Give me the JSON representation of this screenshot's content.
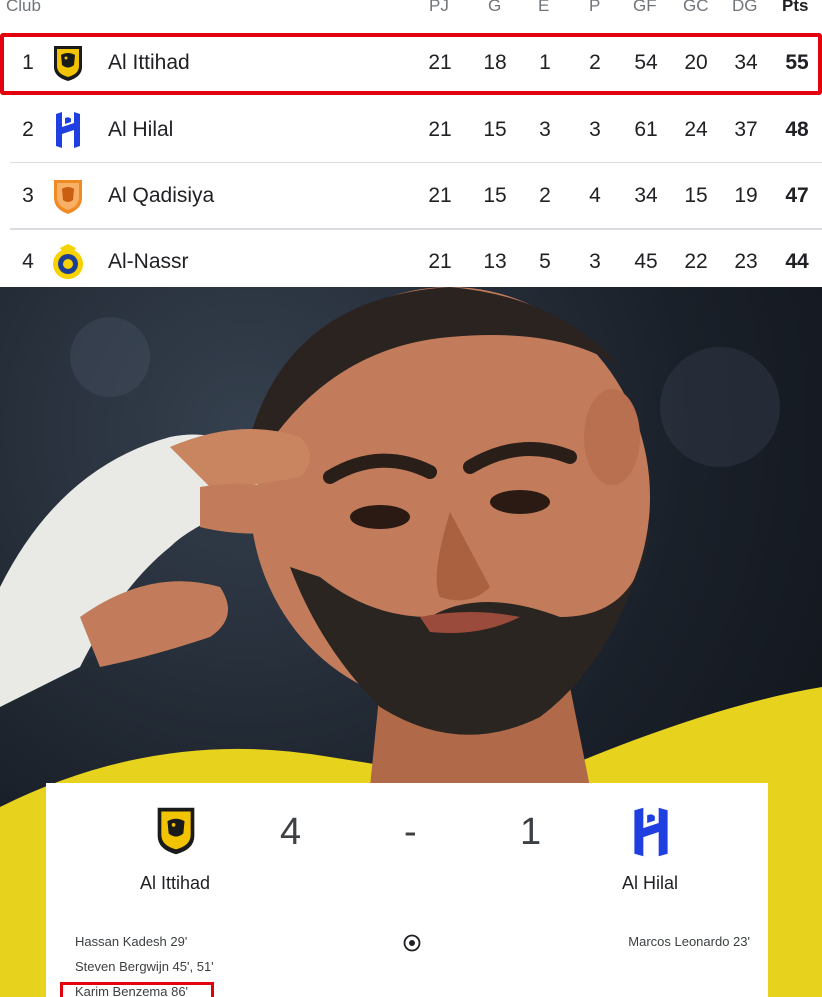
{
  "table": {
    "headers": {
      "club": "Club",
      "pj": "PJ",
      "g": "G",
      "e": "E",
      "p": "P",
      "gf": "GF",
      "gc": "GC",
      "dg": "DG",
      "pts": "Pts"
    },
    "rows": [
      {
        "rank": "1",
        "team": "Al Ittihad",
        "pj": "21",
        "g": "18",
        "e": "1",
        "p": "2",
        "gf": "54",
        "gc": "20",
        "dg": "34",
        "pts": "55",
        "logo": "al-ittihad-crest"
      },
      {
        "rank": "2",
        "team": "Al Hilal",
        "pj": "21",
        "g": "15",
        "e": "3",
        "p": "3",
        "gf": "61",
        "gc": "24",
        "dg": "37",
        "pts": "48",
        "logo": "al-hilal-crest"
      },
      {
        "rank": "3",
        "team": "Al Qadisiya",
        "pj": "21",
        "g": "15",
        "e": "2",
        "p": "4",
        "gf": "34",
        "gc": "15",
        "dg": "19",
        "pts": "47",
        "logo": "al-qadisiya-crest"
      },
      {
        "rank": "4",
        "team": "Al-Nassr",
        "pj": "21",
        "g": "13",
        "e": "5",
        "p": "3",
        "gf": "45",
        "gc": "22",
        "dg": "23",
        "pts": "44",
        "logo": "al-nassr-crest"
      }
    ],
    "highlight_color": "#e3000f"
  },
  "match": {
    "home_team": "Al Ittihad",
    "away_team": "Al Hilal",
    "home_score": "4",
    "separator": "-",
    "away_score": "1",
    "home_scorers": [
      "Hassan Kadesh 29'",
      "Steven Bergwijn 45', 51'",
      "Karim Benzema 86'"
    ],
    "away_scorers": [
      "Marcos Leonardo 23'"
    ],
    "ball_icon": "soccer-ball-icon"
  },
  "colors": {
    "ittihad_gold": "#f2c300",
    "ittihad_black": "#1a1a1a",
    "hilal_blue": "#1f3fe0",
    "qadisiya_orange": "#f08a24",
    "nassr_yellow": "#f5d200",
    "highlight_red": "#e3000f"
  }
}
